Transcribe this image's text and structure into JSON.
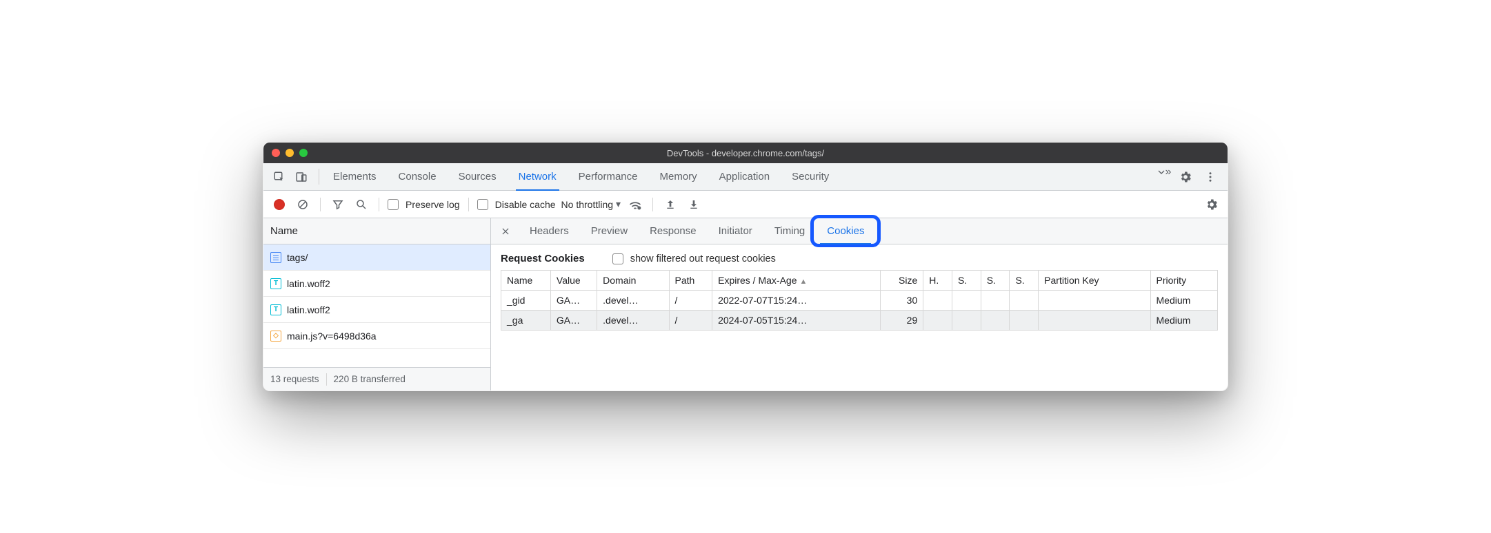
{
  "window": {
    "title": "DevTools - developer.chrome.com/tags/"
  },
  "mainTabs": {
    "items": [
      "Elements",
      "Console",
      "Sources",
      "Network",
      "Performance",
      "Memory",
      "Application",
      "Security"
    ],
    "active": "Network"
  },
  "toolbar": {
    "preserve_log_label": "Preserve log",
    "disable_cache_label": "Disable cache",
    "throttling_label": "No throttling"
  },
  "requests": {
    "header": "Name",
    "items": [
      {
        "icon": "doc",
        "name": "tags/",
        "selected": true
      },
      {
        "icon": "font",
        "name": "latin.woff2"
      },
      {
        "icon": "font",
        "name": "latin.woff2"
      },
      {
        "icon": "js",
        "name": "main.js?v=6498d36a"
      }
    ],
    "status_requests": "13 requests",
    "status_transferred": "220 B transferred"
  },
  "detailTabs": {
    "items": [
      "Headers",
      "Preview",
      "Response",
      "Initiator",
      "Timing",
      "Cookies"
    ],
    "active": "Cookies"
  },
  "cookies": {
    "title": "Request Cookies",
    "toggle_label": "show filtered out request cookies",
    "columns": [
      "Name",
      "Value",
      "Domain",
      "Path",
      "Expires / Max-Age",
      "Size",
      "H.",
      "S.",
      "S.",
      "S.",
      "Partition Key",
      "Priority"
    ],
    "sort_col": 4,
    "rows": [
      {
        "name": "_gid",
        "value": "GA…",
        "domain": ".devel…",
        "path": "/",
        "expires": "2022-07-07T15:24…",
        "size": "30",
        "h": "",
        "s1": "",
        "s2": "",
        "s3": "",
        "pkey": "",
        "priority": "Medium"
      },
      {
        "name": "_ga",
        "value": "GA…",
        "domain": ".devel…",
        "path": "/",
        "expires": "2024-07-05T15:24…",
        "size": "29",
        "h": "",
        "s1": "",
        "s2": "",
        "s3": "",
        "pkey": "",
        "priority": "Medium"
      }
    ]
  }
}
